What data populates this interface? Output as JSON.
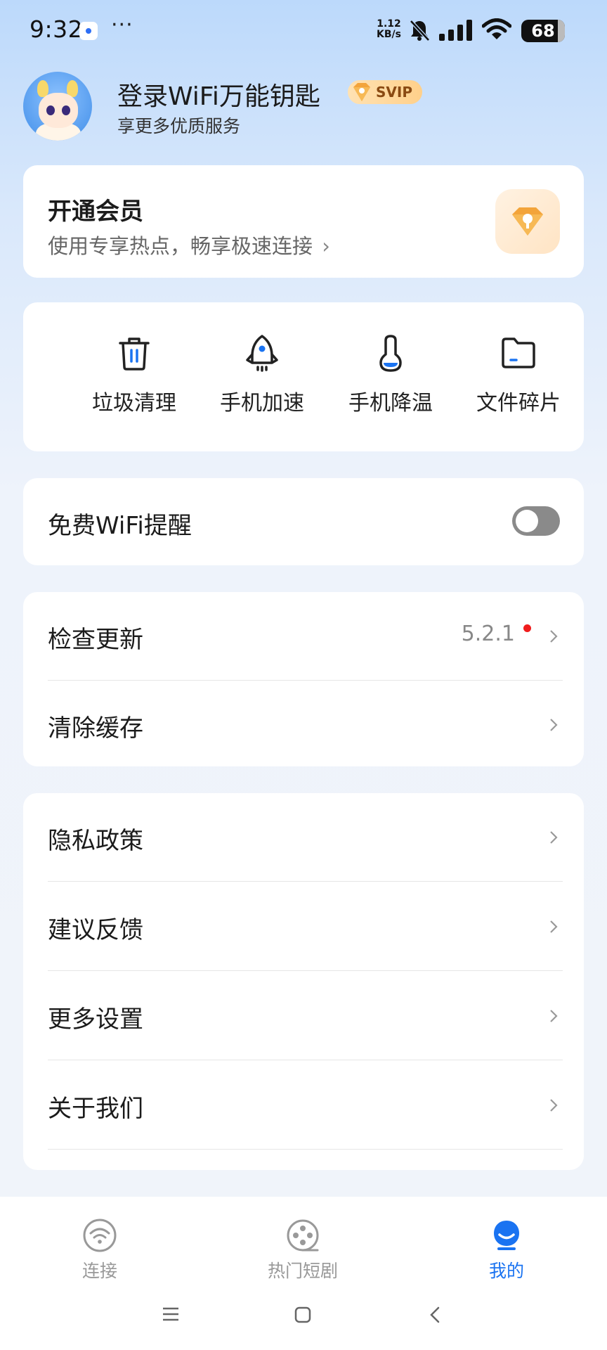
{
  "status_bar": {
    "time": "9:32",
    "more": "···",
    "net_speed_value": "1.12",
    "net_speed_unit": "KB/s",
    "battery": "68"
  },
  "profile": {
    "title": "登录WiFi万能钥匙",
    "badge": "SVIP",
    "subtitle": "享更多优质服务"
  },
  "member": {
    "title": "开通会员",
    "subtitle": "使用专享热点，畅享极速连接",
    "chevron": "›"
  },
  "tools": [
    {
      "label": "垃圾清理",
      "icon": "trash-icon"
    },
    {
      "label": "手机加速",
      "icon": "rocket-icon"
    },
    {
      "label": "手机降温",
      "icon": "thermometer-icon"
    },
    {
      "label": "文件碎片",
      "icon": "folder-icon"
    }
  ],
  "wifi_reminder": {
    "label": "免费WiFi提醒",
    "enabled": false
  },
  "update_section": [
    {
      "label": "检查更新",
      "value": "5.2.1",
      "has_dot": true
    },
    {
      "label": "清除缓存"
    }
  ],
  "settings_section": [
    {
      "label": "隐私政策"
    },
    {
      "label": "建议反馈"
    },
    {
      "label": "更多设置"
    },
    {
      "label": "关于我们"
    }
  ],
  "bottom_nav": [
    {
      "label": "连接",
      "icon": "wifi-icon",
      "active": false
    },
    {
      "label": "热门短剧",
      "icon": "film-reel-icon",
      "active": false
    },
    {
      "label": "我的",
      "icon": "profile-icon",
      "active": true
    }
  ],
  "colors": {
    "accent": "#1a73f1",
    "toggle_off": "#8a8a8a",
    "badge_dot": "#f01d1d",
    "svip_gold": "#ffd08a"
  }
}
